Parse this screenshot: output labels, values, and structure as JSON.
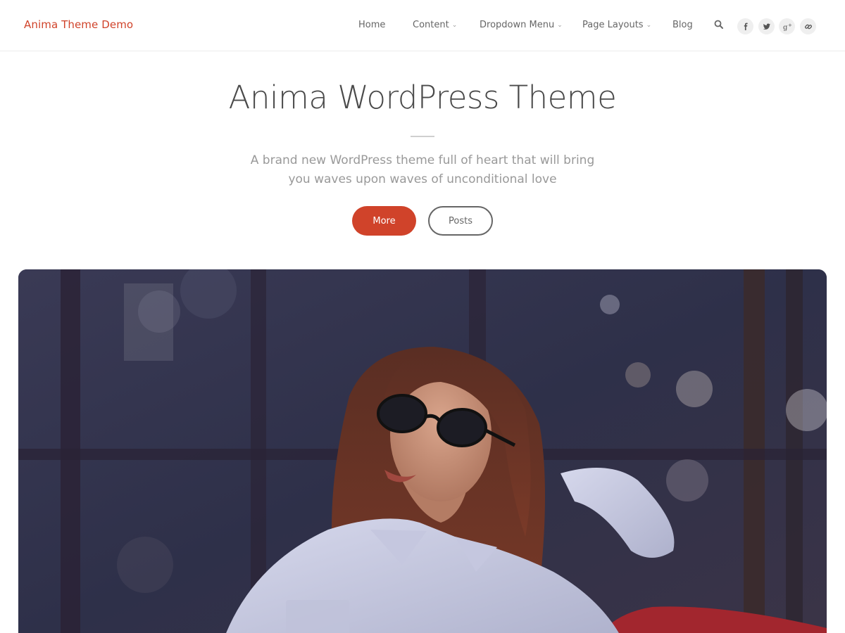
{
  "site": {
    "title": "Anima Theme Demo",
    "accent": "#d0432a"
  },
  "nav": {
    "items": [
      {
        "label": "Home",
        "has_dropdown": false
      },
      {
        "label": "Content",
        "has_dropdown": true
      },
      {
        "label": "Dropdown Menu",
        "has_dropdown": true
      },
      {
        "label": "Page Layouts",
        "has_dropdown": true
      },
      {
        "label": "Blog",
        "has_dropdown": false
      }
    ],
    "chevron": "⌄",
    "search_icon": "search-icon",
    "social": [
      {
        "icon": "facebook-icon",
        "glyph": "f"
      },
      {
        "icon": "twitter-icon",
        "glyph": "t"
      },
      {
        "icon": "google-plus-icon",
        "glyph": "g+"
      },
      {
        "icon": "link-icon",
        "glyph": "link"
      }
    ]
  },
  "hero": {
    "title": "Anima WordPress Theme",
    "subtitle_line1": "A brand new WordPress theme full of heart that will bring",
    "subtitle_line2": "you waves upon waves of unconditional love",
    "buttons": {
      "primary": "More",
      "secondary": "Posts"
    }
  },
  "feature_image": {
    "subject": "woman-with-sunglasses-photo"
  }
}
